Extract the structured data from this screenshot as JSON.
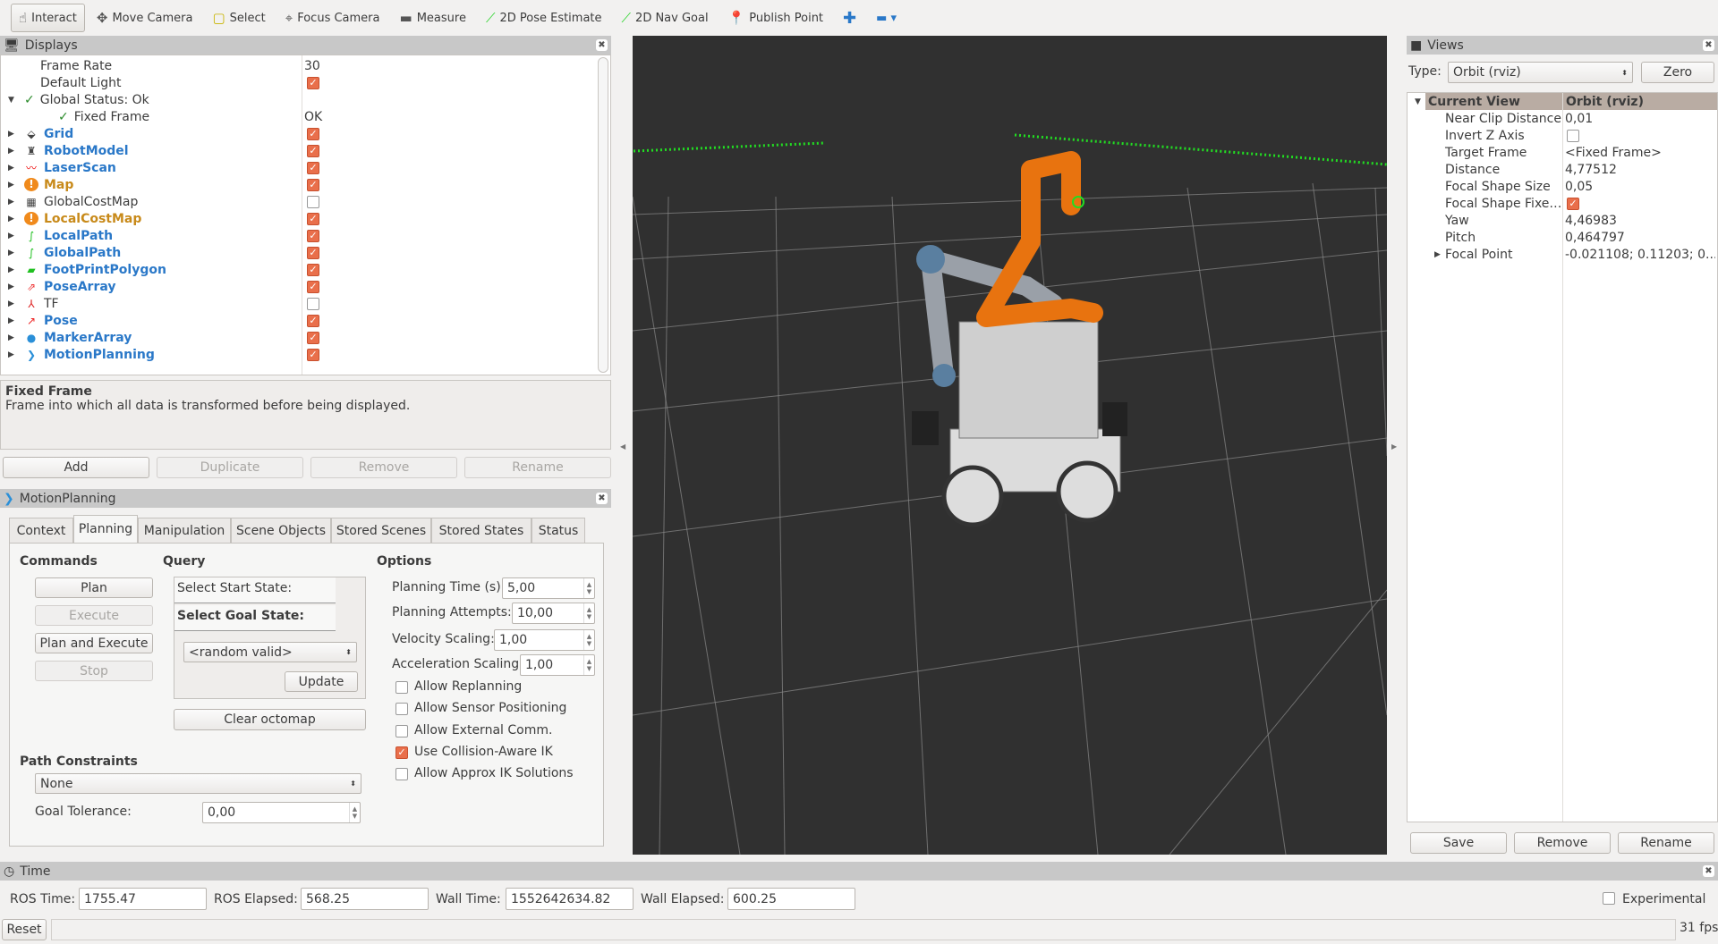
{
  "toolbar": {
    "tools": [
      {
        "label": "Interact",
        "icon": "hand-pointer-icon",
        "active": true
      },
      {
        "label": "Move Camera",
        "icon": "move-arrows-icon"
      },
      {
        "label": "Select",
        "icon": "select-box-icon"
      },
      {
        "label": "Focus Camera",
        "icon": "crosshair-icon"
      },
      {
        "label": "Measure",
        "icon": "ruler-icon"
      },
      {
        "label": "2D Pose Estimate",
        "icon": "green-arrow-icon"
      },
      {
        "label": "2D Nav Goal",
        "icon": "green-arrow-icon"
      },
      {
        "label": "Publish Point",
        "icon": "map-pin-icon"
      }
    ]
  },
  "displays": {
    "title": "Displays",
    "rows": [
      {
        "name": "Frame Rate",
        "value": "30",
        "indent": 2
      },
      {
        "name": "Default Light",
        "checked": true,
        "indent": 2
      },
      {
        "name": "Global Status: Ok",
        "expanded": true,
        "status": "ok",
        "indent": 1
      },
      {
        "name": "Fixed Frame",
        "value": "OK",
        "status": "ok",
        "indent": 2
      },
      {
        "name": "Grid",
        "checked": true,
        "style": "blue",
        "icon": "grid-icon"
      },
      {
        "name": "RobotModel",
        "checked": true,
        "style": "blue",
        "icon": "robot-icon"
      },
      {
        "name": "LaserScan",
        "checked": true,
        "style": "blue",
        "icon": "laser-icon"
      },
      {
        "name": "Map",
        "checked": true,
        "style": "orange",
        "icon": "warning-icon"
      },
      {
        "name": "GlobalCostMap",
        "checked": false,
        "style": "",
        "icon": "costmap-icon"
      },
      {
        "name": "LocalCostMap",
        "checked": true,
        "style": "orange",
        "icon": "warning-icon"
      },
      {
        "name": "LocalPath",
        "checked": true,
        "style": "blue",
        "icon": "path-icon"
      },
      {
        "name": "GlobalPath",
        "checked": true,
        "style": "blue",
        "icon": "path-icon"
      },
      {
        "name": "FootPrintPolygon",
        "checked": true,
        "style": "blue",
        "icon": "polygon-icon"
      },
      {
        "name": "PoseArray",
        "checked": true,
        "style": "blue",
        "icon": "pose-array-icon"
      },
      {
        "name": "TF",
        "checked": false,
        "style": "",
        "icon": "tf-axes-icon"
      },
      {
        "name": "Pose",
        "checked": true,
        "style": "blue",
        "icon": "pose-arrow-icon"
      },
      {
        "name": "MarkerArray",
        "checked": true,
        "style": "blue",
        "icon": "markers-icon"
      },
      {
        "name": "MotionPlanning",
        "checked": true,
        "style": "blue",
        "icon": "motion-planning-icon"
      }
    ],
    "description": {
      "title": "Fixed Frame",
      "text": "Frame into which all data is transformed before being displayed."
    },
    "buttons": {
      "add": "Add",
      "duplicate": "Duplicate",
      "remove": "Remove",
      "rename": "Rename"
    }
  },
  "motion": {
    "title": "MotionPlanning",
    "tabs": [
      "Context",
      "Planning",
      "Manipulation",
      "Scene Objects",
      "Stored Scenes",
      "Stored States",
      "Status"
    ],
    "active_tab": "Planning",
    "commands": {
      "label": "Commands",
      "plan": "Plan",
      "execute": "Execute",
      "plan_execute": "Plan and Execute",
      "stop": "Stop"
    },
    "query": {
      "label": "Query",
      "start": "Select Start State:",
      "goal": "Select Goal State:",
      "goal_value": "<random valid>",
      "update": "Update",
      "clear": "Clear octomap"
    },
    "options": {
      "label": "Options",
      "planning_time": {
        "label": "Planning Time (s):",
        "value": "5,00"
      },
      "planning_attempts": {
        "label": "Planning Attempts:",
        "value": "10,00"
      },
      "velocity": {
        "label": "Velocity Scaling:",
        "value": "1,00"
      },
      "accel": {
        "label": "Acceleration Scaling:",
        "value": "1,00"
      },
      "checks": [
        {
          "label": "Allow Replanning",
          "checked": false
        },
        {
          "label": "Allow Sensor Positioning",
          "checked": false
        },
        {
          "label": "Allow External Comm.",
          "checked": false
        },
        {
          "label": "Use Collision-Aware IK",
          "checked": true
        },
        {
          "label": "Allow Approx IK Solutions",
          "checked": false
        }
      ]
    },
    "path": {
      "label": "Path Constraints",
      "value": "None",
      "tol_label": "Goal Tolerance:",
      "tol_value": "0,00"
    }
  },
  "views": {
    "title": "Views",
    "type_label": "Type:",
    "type_value": "Orbit (rviz)",
    "zero": "Zero",
    "header": {
      "name": "Current View",
      "value": "Orbit (rviz)"
    },
    "rows": [
      {
        "name": "Near Clip Distance",
        "value": "0,01"
      },
      {
        "name": "Invert Z Axis",
        "checked": false
      },
      {
        "name": "Target Frame",
        "value": "<Fixed Frame>"
      },
      {
        "name": "Distance",
        "value": "4,77512"
      },
      {
        "name": "Focal Shape Size",
        "value": "0,05"
      },
      {
        "name": "Focal Shape Fixe…",
        "checked": true
      },
      {
        "name": "Yaw",
        "value": "4,46983"
      },
      {
        "name": "Pitch",
        "value": "0,464797"
      },
      {
        "name": "Focal Point",
        "value": "-0.021108; 0.11203; 0....",
        "expandable": true
      }
    ],
    "save": "Save",
    "remove": "Remove",
    "rename": "Rename"
  },
  "time": {
    "title": "Time",
    "ros_time_label": "ROS Time:",
    "ros_time": "1755.47",
    "ros_elapsed_label": "ROS Elapsed:",
    "ros_elapsed": "568.25",
    "wall_time_label": "Wall Time:",
    "wall_time": "1552642634.82",
    "wall_elapsed_label": "Wall Elapsed:",
    "wall_elapsed": "600.25",
    "experimental": "Experimental"
  },
  "status": {
    "reset": "Reset",
    "fps": "31 fps"
  },
  "colors": {
    "check": "#e96f4b",
    "link_blue": "#2a78c8",
    "warn_orange": "#c88a1a",
    "viewport": "#303030",
    "robot_arm": "#e8730f"
  }
}
